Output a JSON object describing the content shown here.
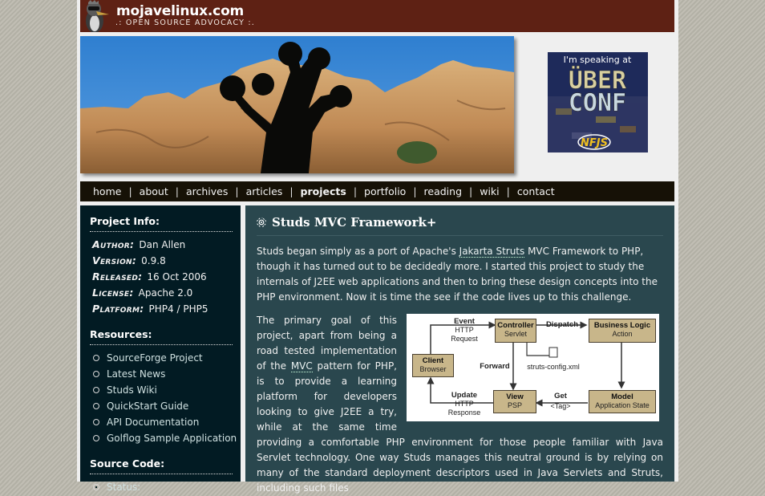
{
  "site": {
    "title": "mojavelinux.com",
    "tagline": ".: OPEN SOURCE ADVOCACY :."
  },
  "ad": {
    "line1": "I'm speaking at",
    "line2": "ÜBER",
    "line3": "CONF",
    "badge": "NFJS"
  },
  "nav": {
    "items": [
      {
        "label": "home",
        "active": false
      },
      {
        "label": "about",
        "active": false
      },
      {
        "label": "archives",
        "active": false
      },
      {
        "label": "articles",
        "active": false
      },
      {
        "label": "projects",
        "active": true
      },
      {
        "label": "portfolio",
        "active": false
      },
      {
        "label": "reading",
        "active": false
      },
      {
        "label": "wiki",
        "active": false
      },
      {
        "label": "contact",
        "active": false
      }
    ],
    "separator": "|"
  },
  "sidebar": {
    "project_info": {
      "heading": "Project Info:",
      "rows": [
        {
          "label": "Author:",
          "value": "Dan Allen"
        },
        {
          "label": "Version:",
          "value": "0.9.8"
        },
        {
          "label": "Released:",
          "value": "16 Oct 2006"
        },
        {
          "label": "License:",
          "value": "Apache 2.0"
        },
        {
          "label": "Platform:",
          "value": "PHP4 / PHP5"
        }
      ]
    },
    "resources": {
      "heading": "Resources:",
      "links": [
        "SourceForge Project",
        "Latest News",
        "Studs Wiki",
        "QuickStart Guide",
        "API Documentation",
        "Golflog Sample Application"
      ]
    },
    "source_code": {
      "heading": "Source Code:",
      "links": [
        "Status:"
      ]
    }
  },
  "content": {
    "title": "Studs MVC Framework+",
    "p1": {
      "before": "Studs began simply as a port of Apache's ",
      "link": "Jakarta Struts",
      "after": " MVC Framework to PHP, though it has turned out to be decidedly more. I started this project to study the internals of J2EE web applications and then to bring these design concepts into the PHP environment. Now it is time the see if the code lives up to this challenge."
    },
    "p2": {
      "before": "The primary goal of this project, apart from being a road tested implementation of the ",
      "link": "MVC",
      "after": " pattern for PHP, is to provide a learning platform for developers looking to give J2EE a try, while at the same time providing a comfortable PHP environment for those people familiar with Java Servlet technology. One way Studs manages this neutral ground is by relying on many of the standard deployment descriptors used in Java Servlets and Struts, including such files"
    },
    "diagram": {
      "client": {
        "title": "Client",
        "sub": "Browser"
      },
      "controller": {
        "title": "Controller",
        "sub": "Servlet"
      },
      "business": {
        "title": "Business Logic",
        "sub": "Action"
      },
      "view": {
        "title": "View",
        "sub": "PSP"
      },
      "model": {
        "title": "Model",
        "sub": "Application State"
      },
      "event": {
        "title": "Event",
        "sub1": "HTTP",
        "sub2": "Request"
      },
      "dispatch": "Dispatch",
      "forward": "Forward",
      "config_file": "struts-config.xml",
      "update": {
        "title": "Update",
        "sub1": "HTTP",
        "sub2": "Response"
      },
      "get": {
        "title": "Get",
        "sub": "<Tag>"
      }
    }
  }
}
